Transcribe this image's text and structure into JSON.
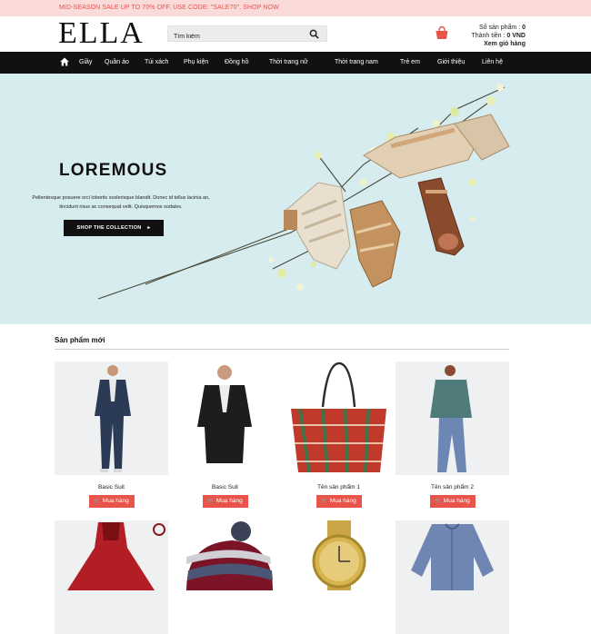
{
  "promo": {
    "text": "MID-SEASON SALE UP TO 70% OFF. USE CODE: \"SALE70\". SHOP NOW"
  },
  "header": {
    "logo": "ELLA",
    "search_placeholder": "Tìm kiếm",
    "cart": {
      "count_label": "Số sản phẩm : ",
      "count_value": "0",
      "total_label": "Thành tiền : ",
      "total_value": "0 VND",
      "view_label": "Xem giỏ hàng"
    }
  },
  "nav": {
    "items": [
      "Giầy",
      "Quần áo",
      "Túi xách",
      "Phụ kiện",
      "Đồng hồ",
      "Thời trang nữ",
      "Thời trang nam",
      "Trẻ em",
      "Giới thiệu",
      "Liên hệ"
    ]
  },
  "hero": {
    "title": "LOREMOUS",
    "text": "Pellentesque posuere orci lobortis scelerisque blandit. Donec id tellus lacinia an, tincidunt risus ac consequat velit. Quisquemos sodales.",
    "button": "SHOP THE COLLECTION"
  },
  "products": {
    "section_title": "Sản phẩm mới",
    "buy_label": "Mua hàng",
    "items": [
      {
        "name": "Basic Suit"
      },
      {
        "name": "Basic Suit"
      },
      {
        "name": "Tên sản phẩm 1"
      },
      {
        "name": "Tên sản phẩm 2"
      }
    ]
  },
  "colors": {
    "accent": "#e8534a",
    "promo_bg": "#fbdada",
    "nav_bg": "#111111",
    "hero_bg": "#d6ecee"
  },
  "icons": [
    "home-icon",
    "search-icon",
    "cart-icon",
    "chevron-right-icon",
    "shopping-cart-icon"
  ]
}
